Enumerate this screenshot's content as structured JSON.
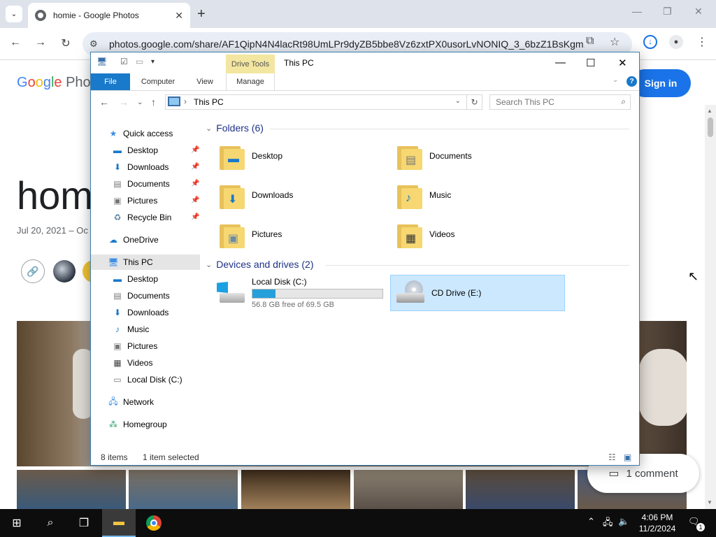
{
  "browser": {
    "tab_title": "homie - Google Photos",
    "url": "photos.google.com/share/AF1QipN4N4lacRt98UmLPr9dyZB5bbe8Vz6zxtPX0usorLvNONIQ_3_6bzZ1BsKgm..."
  },
  "photos_page": {
    "logo": "Google Pho",
    "sign_in": "Sign in",
    "album_title": "hom",
    "album_date": "Jul 20, 2021 – Oc",
    "comment_count": "1 comment"
  },
  "explorer": {
    "window_title": "This PC",
    "contextual_tab": "Drive Tools",
    "ribbon_tabs": [
      "File",
      "Computer",
      "View",
      "Manage"
    ],
    "address": "This PC",
    "search_placeholder": "Search This PC",
    "nav": {
      "quick_access": "Quick access",
      "quick_items": [
        "Desktop",
        "Downloads",
        "Documents",
        "Pictures",
        "Recycle Bin"
      ],
      "onedrive": "OneDrive",
      "this_pc": "This PC",
      "pc_items": [
        "Desktop",
        "Documents",
        "Downloads",
        "Music",
        "Pictures",
        "Videos",
        "Local Disk (C:)"
      ],
      "network": "Network",
      "homegroup": "Homegroup"
    },
    "folders_header": "Folders (6)",
    "folders": [
      "Desktop",
      "Documents",
      "Downloads",
      "Music",
      "Pictures",
      "Videos"
    ],
    "devices_header": "Devices and drives (2)",
    "drives": [
      {
        "name": "Local Disk (C:)",
        "free": "56.8 GB free of 69.5 GB",
        "used_fraction": 0.18
      },
      {
        "name": "CD Drive (E:)"
      }
    ],
    "status_items": "8 items",
    "status_selected": "1 item selected"
  },
  "taskbar": {
    "time": "4:06 PM",
    "date": "11/2/2024",
    "notifications": "1"
  }
}
